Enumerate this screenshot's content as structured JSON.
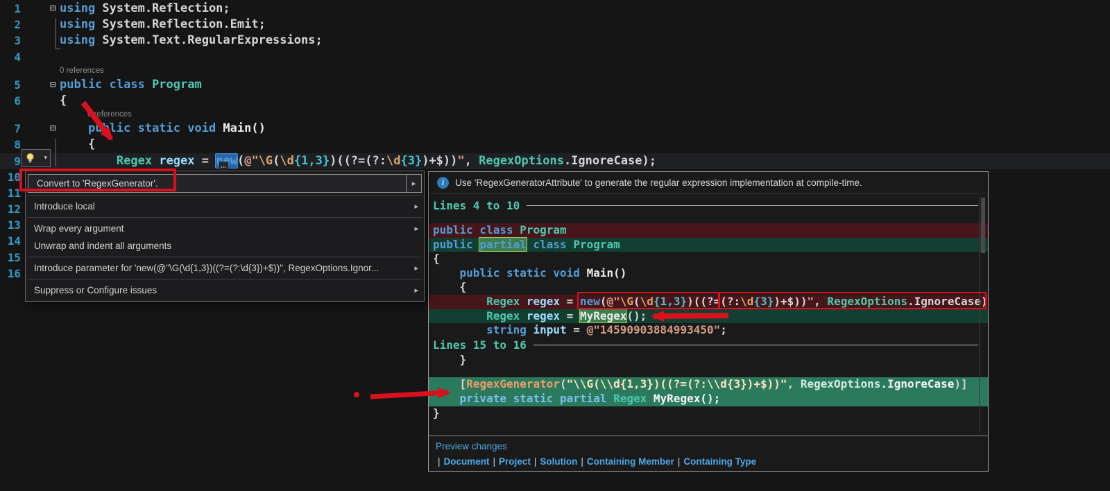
{
  "colors": {
    "editor-bg": "#151515",
    "pane-bg": "#1a1a1a",
    "menu-bg": "#1c1c1e",
    "kw": "#569cd6",
    "type": "#4ec9b0",
    "ident": "#9cdcfe",
    "plain": "#d6d6d6",
    "string": "#d69d85",
    "escape": "#dca56a",
    "quant": "#45c4ce",
    "method": "#ececec",
    "linenum": "#2f9bc8",
    "removed-bg": "#47161a",
    "added-bg": "#123f31",
    "block-bg": "#2b7a5e",
    "box-bg": "#3d7f4c",
    "box-border": "#a2c964",
    "selection": "#2667ac",
    "annotation": "#d9111c",
    "link": "#4fa9e8",
    "sep-label": "#4ec9b0",
    "attr": "#ef9e6a",
    "info-bg": "#2c7bb8"
  },
  "editor": {
    "codelens": "0 references",
    "inline_ellipsis": "…",
    "fold_glyph": "⊟",
    "lines": [
      {
        "num": "1",
        "code": [
          {
            "t": "using ",
            "c": "k"
          },
          {
            "t": "System.Reflection;",
            "c": "p"
          }
        ]
      },
      {
        "num": "2",
        "code": [
          {
            "t": "using ",
            "c": "k"
          },
          {
            "t": "System.Reflection.Emit;",
            "c": "p"
          }
        ]
      },
      {
        "num": "3",
        "code": [
          {
            "t": "using ",
            "c": "k"
          },
          {
            "t": "System.Text.RegularExpressions;",
            "c": "p"
          }
        ]
      },
      {
        "num": "4",
        "code": []
      },
      {
        "num": "5",
        "code": [
          {
            "t": "public class ",
            "c": "k"
          },
          {
            "t": "Program",
            "c": "t"
          }
        ]
      },
      {
        "num": "6",
        "code": [
          {
            "t": "{",
            "c": "p"
          }
        ]
      },
      {
        "num": "7",
        "code": [
          {
            "t": "    ",
            "c": "p"
          },
          {
            "t": "public static void ",
            "c": "k"
          },
          {
            "t": "Main()",
            "c": "m"
          }
        ]
      },
      {
        "num": "8",
        "code": [
          {
            "t": "    {",
            "c": "p"
          }
        ]
      },
      {
        "num": "9",
        "code": [
          {
            "t": "        ",
            "c": "p"
          },
          {
            "t": "Regex",
            "c": "t"
          },
          {
            "t": " ",
            "c": "p"
          },
          {
            "t": "regex",
            "c": "v"
          },
          {
            "t": " = ",
            "c": "p"
          },
          {
            "t": "new",
            "c": "k sel"
          },
          {
            "t": "(",
            "c": "p"
          },
          {
            "t": "@\"",
            "c": "s"
          },
          {
            "t": "\\G",
            "c": "re"
          },
          {
            "t": "(",
            "c": "p"
          },
          {
            "t": "\\d",
            "c": "re"
          },
          {
            "t": "{1,3}",
            "c": "rq"
          },
          {
            "t": ")((?=(?:",
            "c": "p"
          },
          {
            "t": "\\d",
            "c": "re"
          },
          {
            "t": "{3}",
            "c": "rq"
          },
          {
            "t": ")+$))",
            "c": "p"
          },
          {
            "t": "\"",
            "c": "s"
          },
          {
            "t": ", ",
            "c": "p"
          },
          {
            "t": "RegexOptions",
            "c": "t"
          },
          {
            "t": ".IgnoreCase",
            "c": "p"
          },
          {
            "t": ");",
            "c": "p"
          }
        ]
      },
      {
        "num": "10"
      },
      {
        "num": "11"
      },
      {
        "num": "12"
      },
      {
        "num": "13"
      },
      {
        "num": "14"
      },
      {
        "num": "15"
      },
      {
        "num": "16"
      }
    ]
  },
  "lightbulb": {
    "dropdown_glyph": "▾"
  },
  "menu": {
    "submenu_arrow": "▸",
    "items": [
      {
        "label": "Convert to 'RegexGenerator'."
      },
      {
        "label": "Introduce local"
      },
      {
        "label": "Wrap every argument"
      },
      {
        "label": "Unwrap and indent all arguments"
      },
      {
        "label": "Introduce parameter for 'new(@\"\\G(\\d{1,3})((?=(?:\\d{3})+$))\", RegexOptions.Ignor..."
      },
      {
        "label": "Suppress or Configure issues"
      }
    ]
  },
  "preview": {
    "info_glyph": "i",
    "info_text": "Use 'RegexGeneratorAttribute' to generate the regular expression implementation at compile-time.",
    "rows": [
      {
        "type": "sep",
        "label": "Lines 4 to 10"
      },
      {
        "type": "blank"
      },
      {
        "type": "removed",
        "code": [
          {
            "t": "public class ",
            "c": "k"
          },
          {
            "t": "Program",
            "c": "t"
          }
        ]
      },
      {
        "type": "added",
        "code": [
          {
            "t": "public ",
            "c": "k"
          },
          {
            "t": "partial",
            "c": "k box"
          },
          {
            "t": " ",
            "c": "p"
          },
          {
            "t": "class ",
            "c": "k"
          },
          {
            "t": "Program",
            "c": "t"
          }
        ]
      },
      {
        "type": "code",
        "code": [
          {
            "t": "{",
            "c": "p"
          }
        ]
      },
      {
        "type": "code",
        "code": [
          {
            "t": "    ",
            "c": "p"
          },
          {
            "t": "public static void ",
            "c": "k"
          },
          {
            "t": "Main()",
            "c": "m"
          }
        ]
      },
      {
        "type": "code",
        "code": [
          {
            "t": "    {",
            "c": "p"
          }
        ]
      },
      {
        "type": "removed",
        "code": [
          {
            "t": "        ",
            "c": "p"
          },
          {
            "t": "Regex",
            "c": "t"
          },
          {
            "t": " ",
            "c": "p"
          },
          {
            "t": "regex",
            "c": "v"
          },
          {
            "t": " = ",
            "c": "p"
          },
          {
            "t": "new",
            "c": "k"
          },
          {
            "t": "(",
            "c": "p"
          },
          {
            "t": "@\"",
            "c": "s"
          },
          {
            "t": "\\G",
            "c": "re"
          },
          {
            "t": "(",
            "c": "p"
          },
          {
            "t": "\\d",
            "c": "re"
          },
          {
            "t": "{1,3}",
            "c": "rq"
          },
          {
            "t": ")((?=(?:",
            "c": "p"
          },
          {
            "t": "\\d",
            "c": "re"
          },
          {
            "t": "{3}",
            "c": "rq"
          },
          {
            "t": ")+$))",
            "c": "p"
          },
          {
            "t": "\"",
            "c": "s"
          },
          {
            "t": ", ",
            "c": "p"
          },
          {
            "t": "RegexOptions",
            "c": "t"
          },
          {
            "t": ".IgnoreCase",
            "c": "p"
          },
          {
            "t": ");",
            "c": "p"
          }
        ]
      },
      {
        "type": "added",
        "code": [
          {
            "t": "        ",
            "c": "p"
          },
          {
            "t": "Regex",
            "c": "t"
          },
          {
            "t": " ",
            "c": "p"
          },
          {
            "t": "regex",
            "c": "v"
          },
          {
            "t": " = ",
            "c": "p"
          },
          {
            "t": "MyRegex",
            "c": "m box"
          },
          {
            "t": "();",
            "c": "p"
          }
        ]
      },
      {
        "type": "code",
        "code": [
          {
            "t": "        ",
            "c": "p"
          },
          {
            "t": "string",
            "c": "k"
          },
          {
            "t": " ",
            "c": "p"
          },
          {
            "t": "input",
            "c": "v"
          },
          {
            "t": " = ",
            "c": "p"
          },
          {
            "t": "@\"14590903884993450\"",
            "c": "s"
          },
          {
            "t": ";",
            "c": "p"
          }
        ]
      },
      {
        "type": "sep",
        "label": "Lines 15 to 16"
      },
      {
        "type": "code",
        "code": [
          {
            "t": "    }",
            "c": "p"
          }
        ]
      },
      {
        "type": "blank"
      },
      {
        "type": "block",
        "code": [
          {
            "t": "    [",
            "c": "p"
          },
          {
            "t": "RegexGenerator",
            "c": "attr"
          },
          {
            "t": "(",
            "c": "p"
          },
          {
            "t": "\"\\\\G(\\\\d{1,3})((?=(?:\\\\d{3})+$))\"",
            "c": "sw"
          },
          {
            "t": ", ",
            "c": "p"
          },
          {
            "t": "RegexOptions",
            "c": "t2"
          },
          {
            "t": ".IgnoreCase",
            "c": "pb"
          },
          {
            "t": ")]",
            "c": "p"
          }
        ]
      },
      {
        "type": "block",
        "code": [
          {
            "t": "    ",
            "c": "p"
          },
          {
            "t": "private static partial ",
            "c": "k2"
          },
          {
            "t": "Regex",
            "c": "t"
          },
          {
            "t": " ",
            "c": "p"
          },
          {
            "t": "MyRegex();",
            "c": "pb"
          }
        ]
      },
      {
        "type": "code",
        "code": [
          {
            "t": "}",
            "c": "p"
          }
        ]
      }
    ],
    "footer": {
      "preview_changes": "Preview changes",
      "pipe": "|",
      "scopes": [
        "Document",
        "Project",
        "Solution",
        "Containing Member",
        "Containing Type"
      ]
    }
  }
}
